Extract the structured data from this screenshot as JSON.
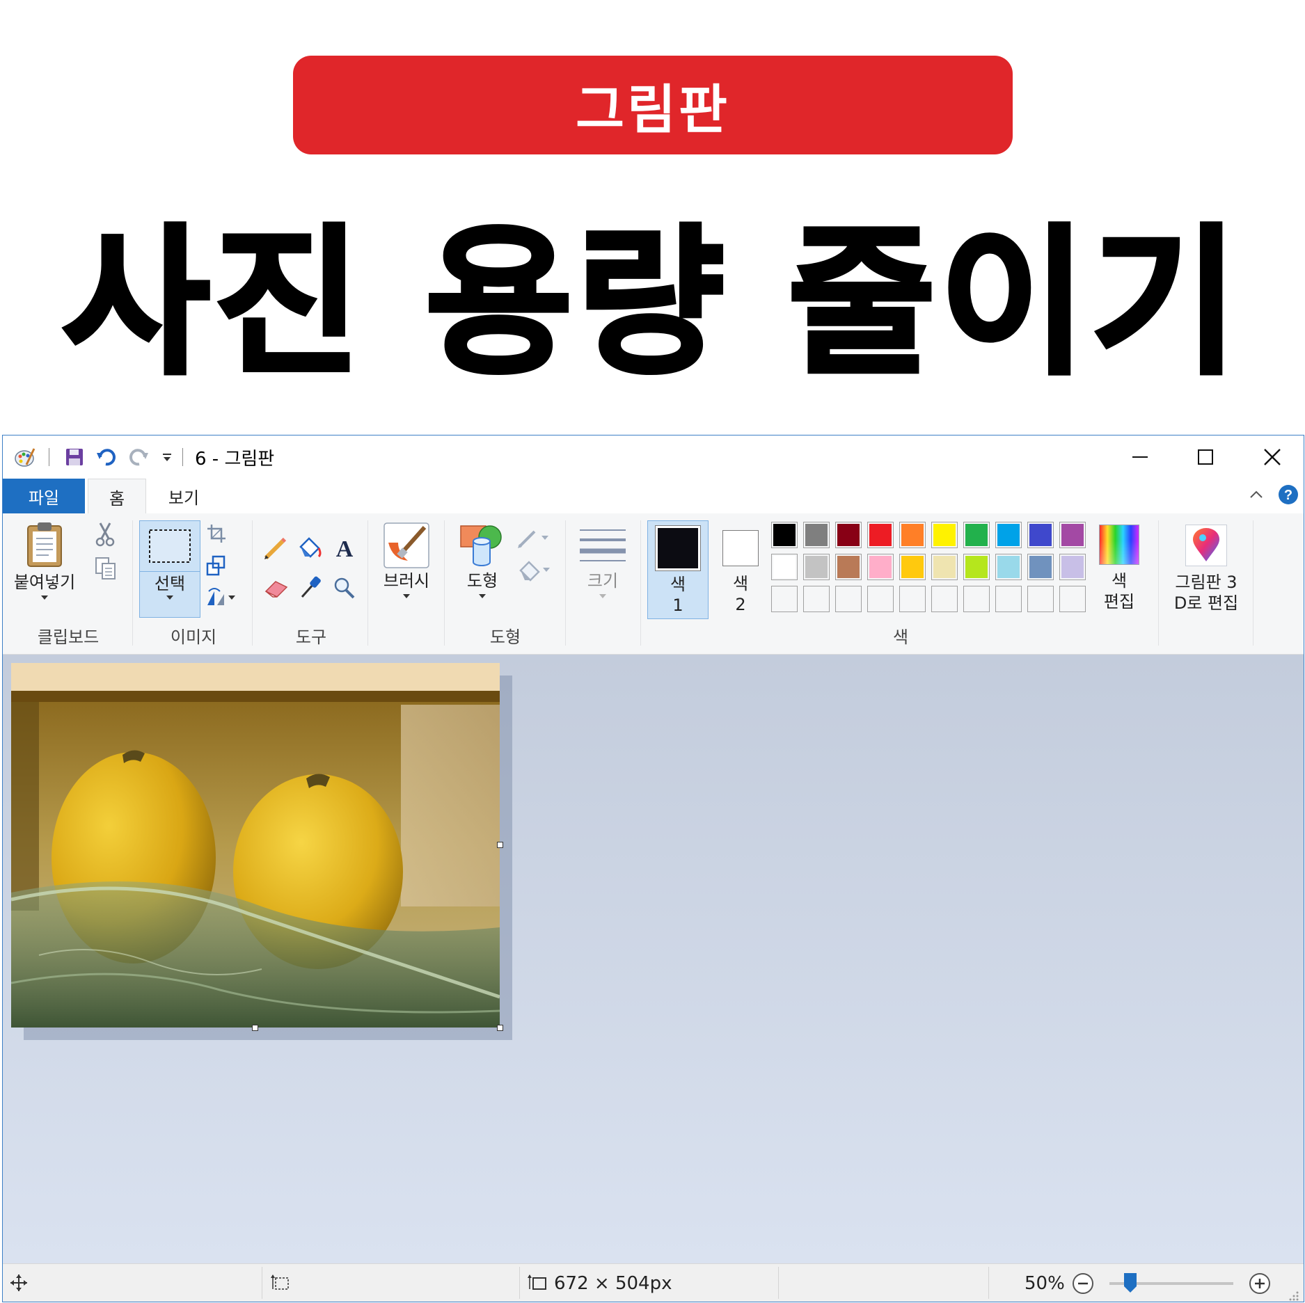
{
  "banner": {
    "badge": "그림판",
    "headline": "사진 용량 줄이기"
  },
  "window": {
    "title": "6 - 그림판",
    "controls": {
      "minimize": "minimize-icon",
      "maximize": "maximize-icon",
      "close": "close-icon"
    }
  },
  "tabs": [
    {
      "label": "파일"
    },
    {
      "label": "홈"
    },
    {
      "label": "보기"
    }
  ],
  "ribbon": {
    "clipboard": {
      "paste": "붙여넣기",
      "group": "클립보드"
    },
    "image": {
      "select": "선택",
      "group": "이미지"
    },
    "tools": {
      "group": "도구"
    },
    "brush": {
      "label": "브러시"
    },
    "shapes": {
      "label": "도형",
      "group": "도형"
    },
    "size": {
      "label": "크기"
    },
    "colors": {
      "color1_line1": "색",
      "color1_line2": "1",
      "color2_line1": "색",
      "color2_line2": "2",
      "edit_line1": "색",
      "edit_line2": "편집",
      "paint3d_line1": "그림판 3",
      "paint3d_line2": "D로 편집",
      "group": "색",
      "palette_row1": [
        "#000000",
        "#7f7f7f",
        "#880015",
        "#ed1c24",
        "#ff7f27",
        "#fff200",
        "#22b14c",
        "#00a2e8",
        "#3f48cc",
        "#a349a4"
      ],
      "palette_row2": [
        "#ffffff",
        "#c3c3c3",
        "#b97a57",
        "#ffaec9",
        "#ffc90e",
        "#efe4b0",
        "#b5e61d",
        "#99d9ea",
        "#7092be",
        "#c8bfe7"
      ]
    }
  },
  "status": {
    "dimensions": "672 × 504px",
    "zoom": "50%",
    "zoom_level": 0.5
  },
  "colors": {
    "accent": "#e0262a",
    "file_tab": "#1e6fc2"
  }
}
